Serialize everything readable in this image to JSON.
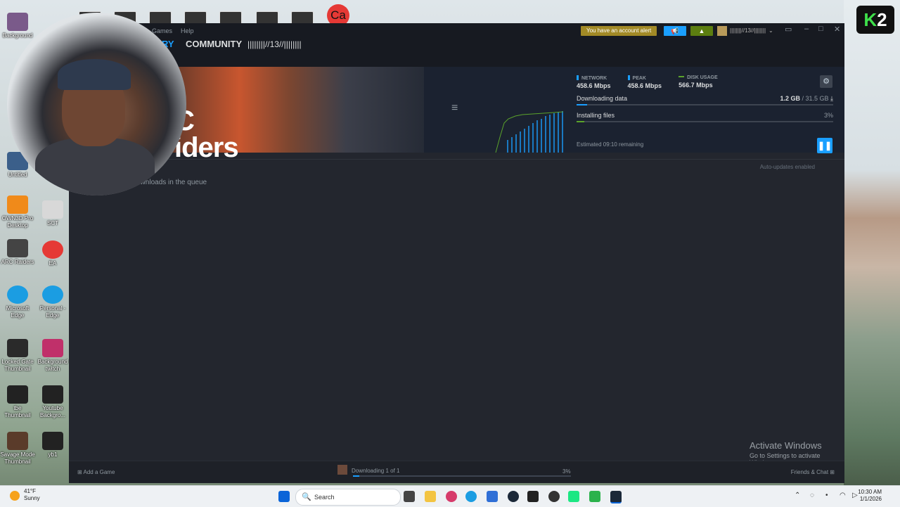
{
  "desktop": {
    "left_icons": [
      {
        "label": "Background",
        "color": "#7a5a8a"
      },
      {
        "label": "Untitled",
        "color": "#3b5f8a"
      },
      {
        "label": "OWN3D Pro Desktop",
        "color": "#f08a1a"
      },
      {
        "label": "SCT",
        "color": "#d8d8d8"
      },
      {
        "label": "ARC Raiders",
        "color": "#444444"
      },
      {
        "label": "EA",
        "color": "#e53935"
      },
      {
        "label": "Microsoft Edge",
        "color": "#1b9de2"
      },
      {
        "label": "Personal - Edge",
        "color": "#1b9de2"
      },
      {
        "label": "Locked Gate Thumbnail",
        "color": "#2a2a2a"
      },
      {
        "label": "Background twitch",
        "color": "#c0306a"
      },
      {
        "label": "tbe Thumbnail",
        "color": "#222222"
      },
      {
        "label": "Youtube Backgro...",
        "color": "#222222"
      },
      {
        "label": "Savage Mode Thumbnail",
        "color": "#5a3b2a"
      },
      {
        "label": "yb1",
        "color": "#222222"
      }
    ],
    "top_badge": "Ca",
    "k2_logo": {
      "k": "K",
      "num": "2"
    }
  },
  "steam": {
    "menu": [
      "Games",
      "Help"
    ],
    "nav": {
      "library": "RY",
      "community": "COMMUNITY",
      "username": "||||||||//13//||||||||"
    },
    "account_alert": "You have an account alert",
    "account_name": "||||||||//13//||||||||",
    "game_title": "C\niders",
    "stats": [
      {
        "label": "NETWORK",
        "value": "458.6 Mbps",
        "color": "#1a9fff"
      },
      {
        "label": "PEAK",
        "value": "458.6 Mbps",
        "color": "#1a9fff"
      },
      {
        "label": "DISK USAGE",
        "value": "566.7 Mbps",
        "color": "#5ba32b"
      }
    ],
    "downloading_label": "Downloading data",
    "downloading_size": "1.2 GB",
    "downloading_total": "/ 31.5 GB",
    "downloading_progress": 0.04,
    "installing_label": "Installing files",
    "installing_percent": "3%",
    "installing_progress": 0.03,
    "estimated": "Estimated 09:10 remaining",
    "auto_updates": "Auto-updates enabled",
    "queue_text": "ownloads in the queue",
    "add_game": "Add a Game",
    "bottom_downloading": "Downloading 1 of 1",
    "bottom_percent": "3%",
    "friends_chat": "Friends & Chat"
  },
  "watermark": {
    "line1": "Activate Windows",
    "line2": "Go to Settings to activate Windows."
  },
  "taskbar": {
    "weather_temp": "41°F",
    "weather_desc": "Sunny",
    "search_placeholder": "Search",
    "time": "10:30 AM",
    "date": "1/1/2026"
  }
}
